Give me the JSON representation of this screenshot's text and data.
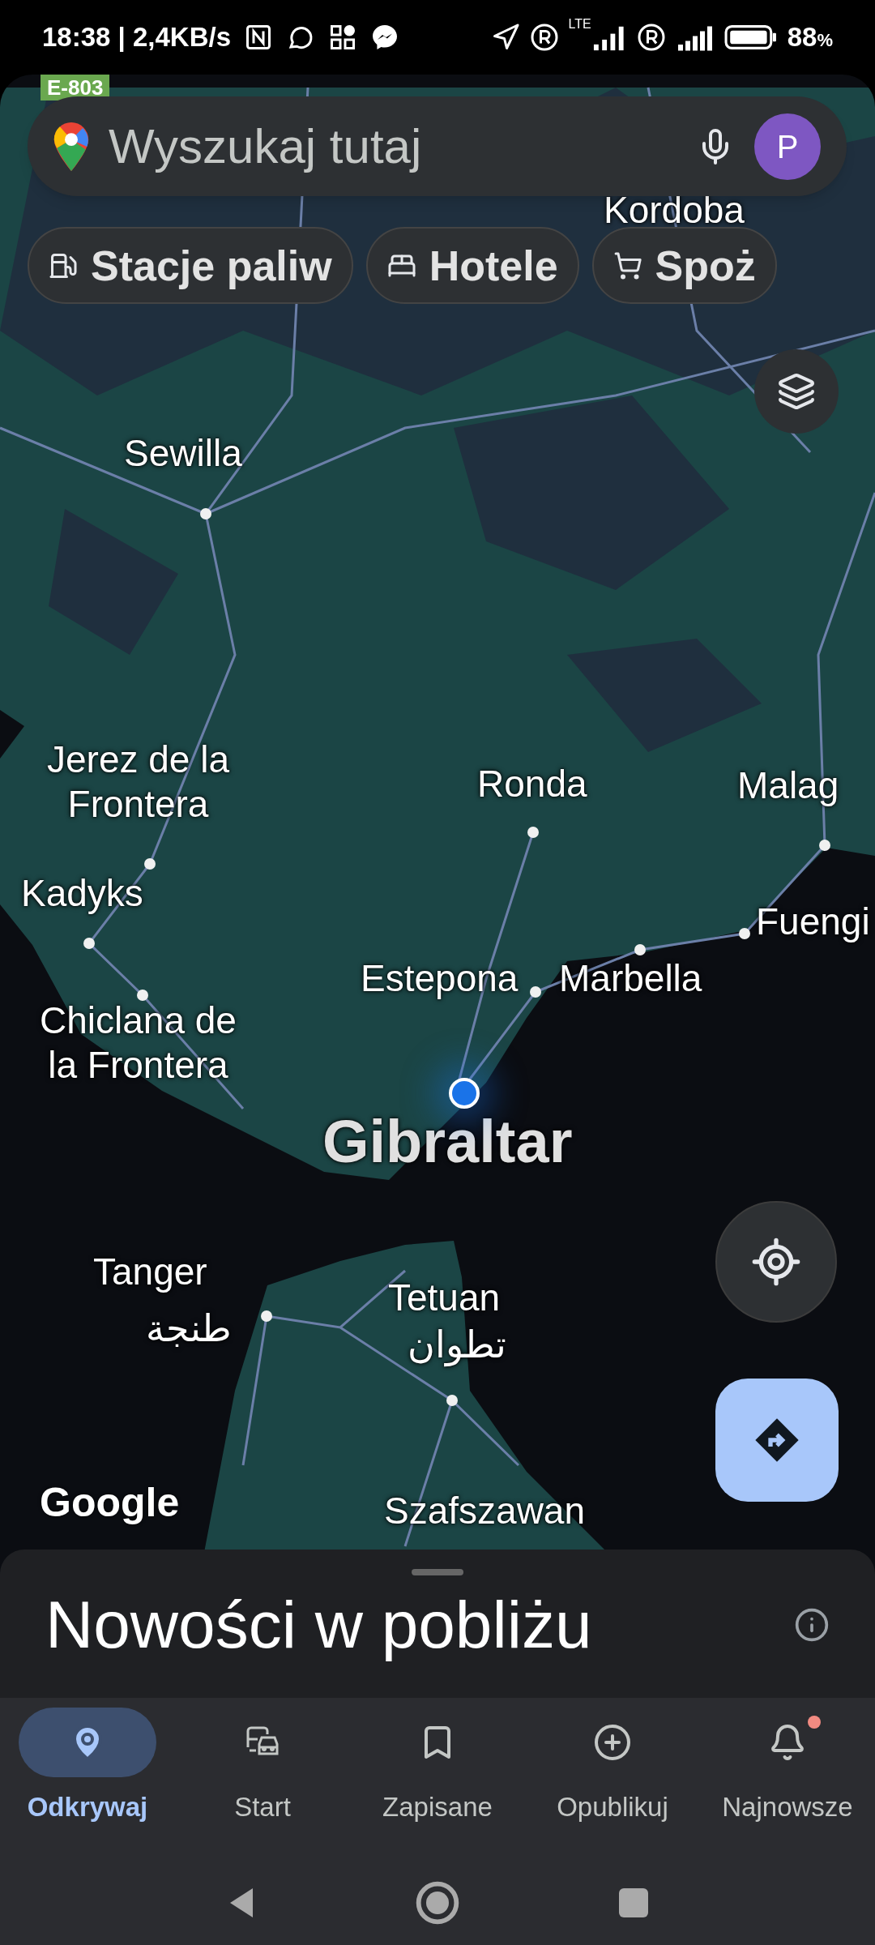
{
  "status_bar": {
    "time": "18:38 | 2,4KB/s",
    "network": "LTE",
    "battery": "88",
    "battery_unit": "%"
  },
  "search": {
    "placeholder": "Wyszukaj tutaj",
    "avatar": "P"
  },
  "chips": [
    {
      "kind": "fuel",
      "label": "Stacje paliw"
    },
    {
      "kind": "hotel",
      "label": "Hotele"
    },
    {
      "kind": "cart",
      "label": "Spoż"
    }
  ],
  "map": {
    "road_sign": "E-803",
    "labels": [
      {
        "kind": "city",
        "text": "Kordoba"
      },
      {
        "kind": "city",
        "text": "Sewilla"
      },
      {
        "kind": "city",
        "text": "Jerez de la\nFrontera"
      },
      {
        "kind": "city",
        "text": "Ronda"
      },
      {
        "kind": "city",
        "text": "Malag"
      },
      {
        "kind": "city",
        "text": "Kadyks"
      },
      {
        "kind": "city",
        "text": "Fuengi"
      },
      {
        "kind": "city",
        "text": "Chiclana de\nla Frontera"
      },
      {
        "kind": "city",
        "text": "Estepona"
      },
      {
        "kind": "city",
        "text": "Marbella"
      },
      {
        "kind": "major",
        "text": "Gibraltar"
      },
      {
        "kind": "city",
        "text": "Tanger"
      },
      {
        "kind": "city",
        "text": "طنجة"
      },
      {
        "kind": "city",
        "text": "Tetuan"
      },
      {
        "kind": "city",
        "text": "تطوان"
      },
      {
        "kind": "city",
        "text": "Szafszawan"
      }
    ],
    "attribution": "Google"
  },
  "sheet": {
    "title": "Nowości w pobliżu"
  },
  "nav": [
    {
      "kind": "explore",
      "label": "Odkrywaj",
      "selected": true
    },
    {
      "kind": "commute",
      "label": "Start",
      "selected": false
    },
    {
      "kind": "saved",
      "label": "Zapisane",
      "selected": false
    },
    {
      "kind": "contribute",
      "label": "Opublikuj",
      "selected": false
    },
    {
      "kind": "updates",
      "label": "Najnowsze",
      "selected": false,
      "badge": true
    }
  ]
}
